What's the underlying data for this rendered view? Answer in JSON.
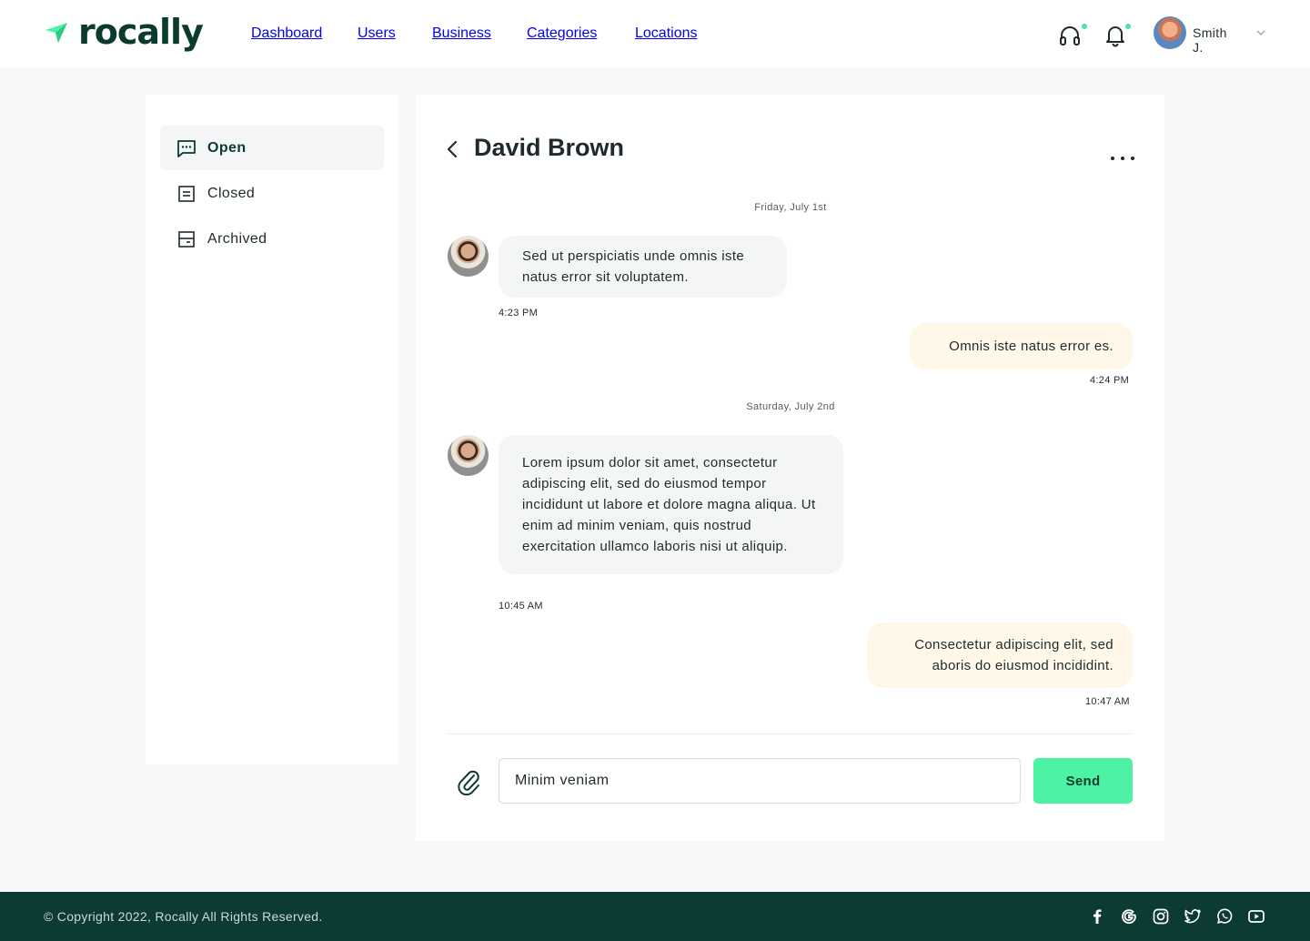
{
  "brand": {
    "name": "rocally",
    "logo_icon": "navigation-arrow-icon",
    "accent": "#4df2a4",
    "dark": "#0b3b2e"
  },
  "nav": {
    "items": [
      "Dashboard",
      "Users",
      "Business",
      "Categories",
      "Locations"
    ]
  },
  "header": {
    "support_icon": "headset-icon",
    "notification_icon": "bell-icon",
    "user_name": "Smith J.",
    "dropdown_icon": "chevron-down-icon"
  },
  "sidebar": {
    "items": [
      {
        "label": "Open",
        "icon": "chat-icon",
        "active": true
      },
      {
        "label": "Closed",
        "icon": "list-icon",
        "active": false
      },
      {
        "label": "Archived",
        "icon": "archive-icon",
        "active": false
      }
    ]
  },
  "chat": {
    "title": "David Brown",
    "dates": [
      "Friday, July 1st",
      "Saturday, July 2nd"
    ],
    "messages": [
      {
        "direction": "in",
        "text": "Sed ut perspiciatis unde omnis iste natus error sit voluptatem.",
        "time": "4:23 PM"
      },
      {
        "direction": "out",
        "text": "Omnis iste natus error es.",
        "time": "4:24 PM"
      },
      {
        "direction": "in",
        "text": "Lorem ipsum dolor sit amet, consectetur adipiscing elit, sed do eiusmod tempor incididunt ut labore et dolore magna aliqua. Ut enim ad minim veniam, quis nostrud exercitation ullamco laboris nisi ut aliquip.",
        "time": "10:45 AM"
      },
      {
        "direction": "out",
        "text": "Consectetur adipiscing elit, sed aboris do eiusmod incididint.",
        "time": "10:47 AM"
      }
    ],
    "input_value": "Minim veniam",
    "send_label": "Send"
  },
  "footer": {
    "copyright": "© Copyright 2022, Rocally All Rights Reserved.",
    "social": [
      "facebook-icon",
      "google-icon",
      "instagram-icon",
      "twitter-icon",
      "whatsapp-icon",
      "youtube-icon"
    ]
  }
}
